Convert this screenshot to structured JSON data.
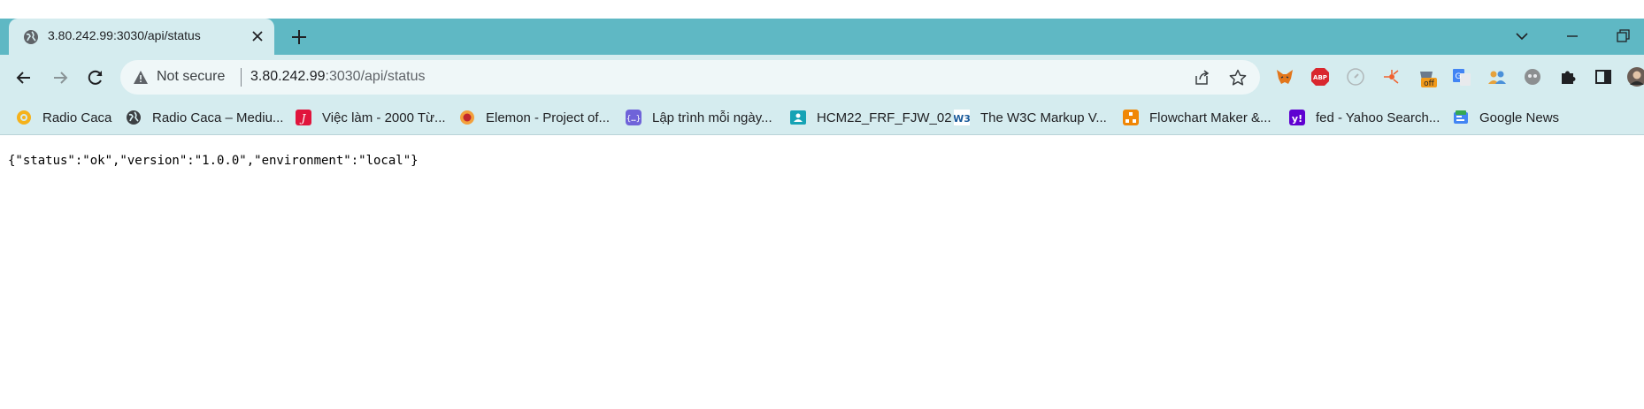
{
  "colors": {
    "tabbar": "#5fb8c4",
    "toolbar": "#d5ecef",
    "active_tab": "#d5ecef",
    "omnibox": "#eff7f8"
  },
  "tab": {
    "title": "3.80.242.99:3030/api/status",
    "favicon": "globe-icon"
  },
  "address_bar": {
    "security_label": "Not secure",
    "url_host": "3.80.242.99",
    "url_rest": ":3030/api/status"
  },
  "extensions": [
    "metamask-icon",
    "adblock-plus-icon",
    "compass-icon",
    "network-icon",
    "extension-off-icon",
    "google-translate-icon",
    "people-icon",
    "robot-icon",
    "puzzle-icon",
    "side-panel-icon",
    "profile-avatar"
  ],
  "extension_badge": "off",
  "bookmarks": [
    {
      "label": "Radio Caca",
      "icon": "radio-caca-icon"
    },
    {
      "label": "Radio Caca – Mediu...",
      "icon": "globe-icon"
    },
    {
      "label": "Việc làm - 2000 Từ...",
      "icon": "jobs-icon"
    },
    {
      "label": "Elemon - Project of...",
      "icon": "elemon-icon"
    },
    {
      "label": "Lập trình mỗi ngày...",
      "icon": "code-icon"
    },
    {
      "label": "HCM22_FRF_FJW_02",
      "icon": "classroom-icon"
    },
    {
      "label": "The W3C Markup V...",
      "icon": "w3c-icon"
    },
    {
      "label": "Flowchart Maker &...",
      "icon": "flowchart-icon"
    },
    {
      "label": "fed - Yahoo Search...",
      "icon": "yahoo-icon"
    },
    {
      "label": "Google News",
      "icon": "google-news-icon"
    }
  ],
  "page": {
    "body": "{\"status\":\"ok\",\"version\":\"1.0.0\",\"environment\":\"local\"}"
  }
}
